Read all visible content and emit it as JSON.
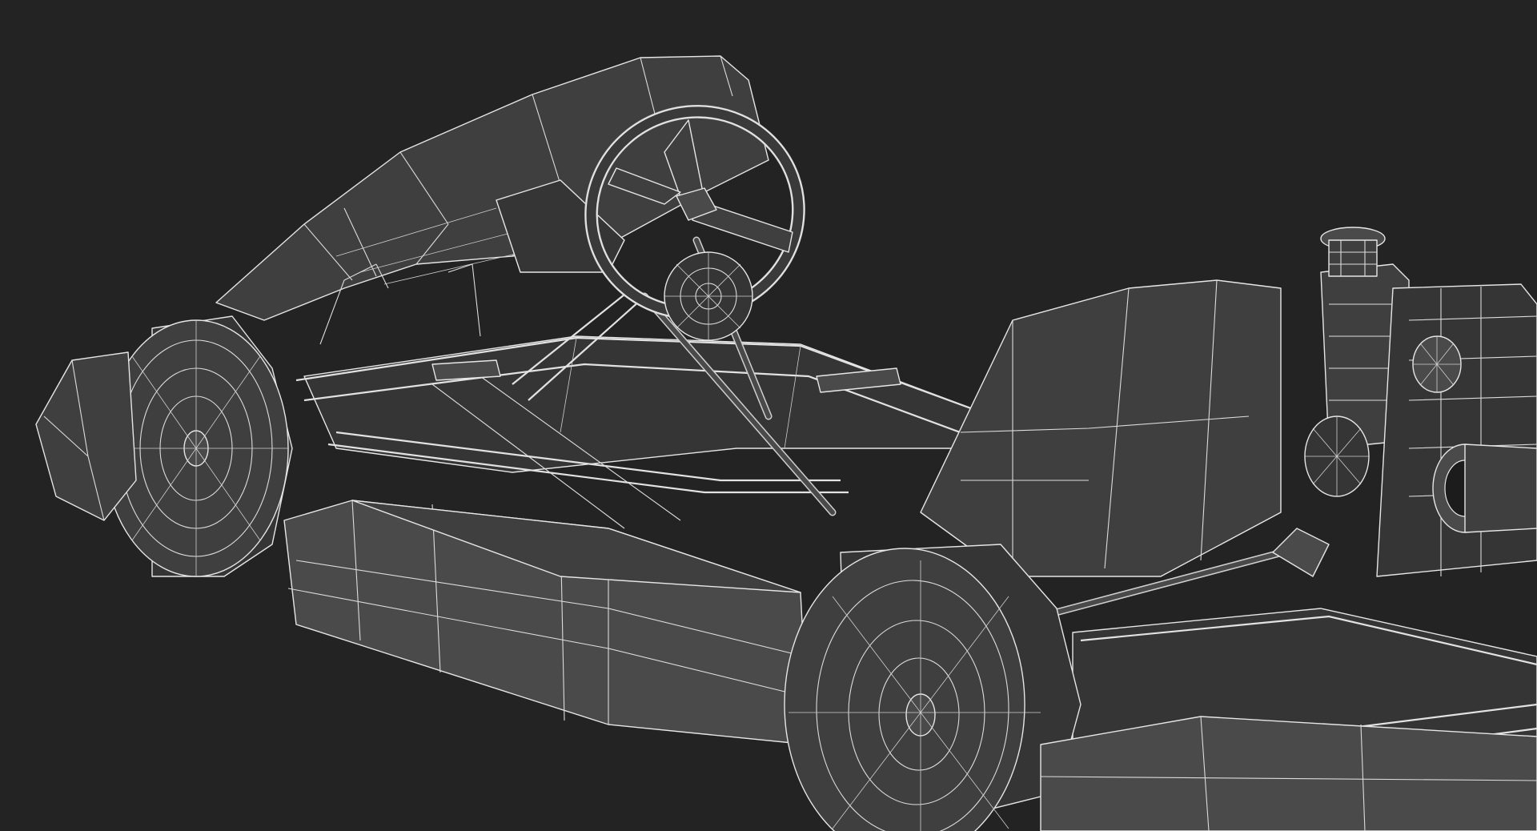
{
  "scene": {
    "subject": "go-kart-wireframe-render",
    "colors": {
      "background": "#232323",
      "surface": "#3f3f3f",
      "wireframe": "#e6e6e6"
    }
  }
}
